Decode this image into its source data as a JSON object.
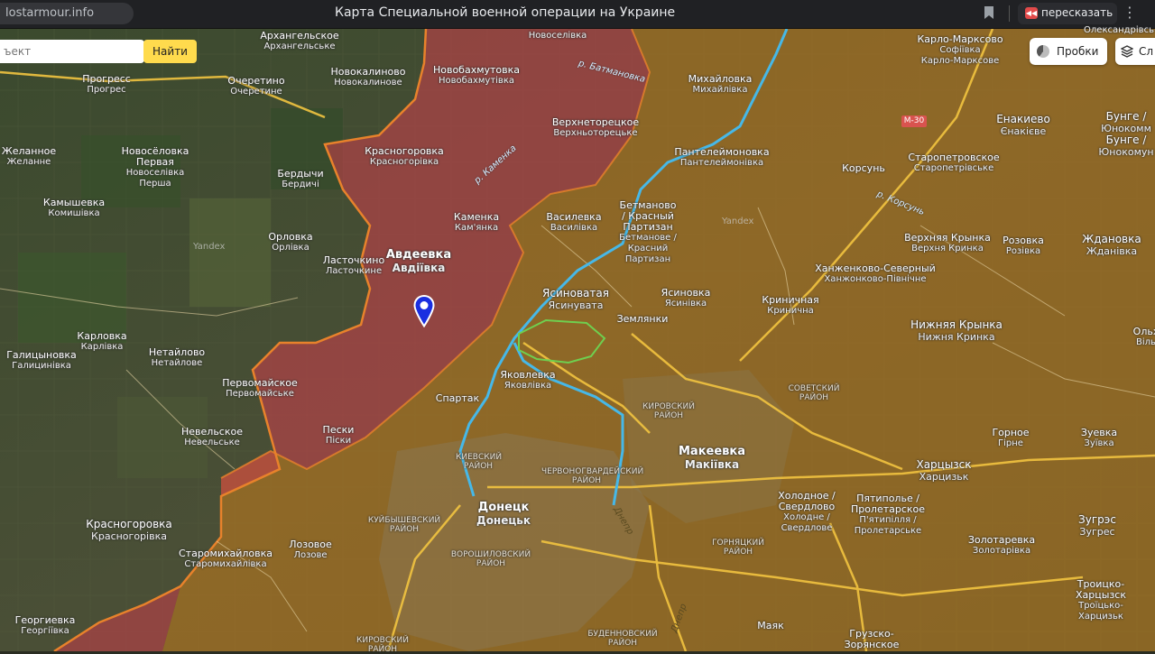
{
  "browser": {
    "url": "lostarmour.info",
    "title": "Карта Специальной военной операции на Украине",
    "retell_label": "пересказать",
    "icons": [
      "bookmark-icon",
      "retell-icon",
      "more-icon"
    ]
  },
  "search": {
    "placeholder": "ъект",
    "button_label": "Найти"
  },
  "controls": {
    "traffic_label": "Пробки",
    "layers_label": "Сл"
  },
  "map": {
    "road_badge": "М-30",
    "watermark": "Yandex",
    "colors": {
      "occupied_zone": "#b8781f",
      "gained_zone": "#c0404a",
      "frontline": "#e8822b",
      "river": "#46b8e8",
      "green_outline": "#6fcf4f",
      "pin": "#1a2fe0"
    },
    "cities": {
      "donetsk": {
        "ru": "Донецк",
        "ua": "Донецьк"
      },
      "makeevka": {
        "ru": "Макеевка",
        "ua": "Макіївка"
      },
      "avdeevka": {
        "ru": "Авдеевка",
        "ua": "Авдіївка"
      },
      "yasinovataya": {
        "ru": "Ясиноватая",
        "ua": "Ясинувата"
      },
      "khartsyzsk": {
        "ru": "Харцызск",
        "ua": "Харцизьк"
      },
      "krasnogorovka_sw": {
        "ru": "Красногоровка",
        "ua": "Красногорівка"
      },
      "enakievo": {
        "ru": "Енакиево",
        "ua": "Єнакієве"
      },
      "nizh_krynka": {
        "ru": "Нижняя Крынка",
        "ua": "Нижня Кринка"
      },
      "zhdanovka": {
        "ru": "Ждановка",
        "ua": "Жданівка"
      },
      "zugres": {
        "ru": "Зугрэс",
        "ua": "Зугрес"
      },
      "bunge": {
        "ru": "Бунге /",
        "ua": "Юнокомм"
      },
      "bunge2": {
        "ru": "Бунге /",
        "ua": "Юнокомун"
      }
    },
    "towns": {
      "arkhangelskoe": {
        "ru": "Архангельское",
        "ua": "Архангельське"
      },
      "novoselovka": {
        "ru": "Новоселівка",
        "ua": ""
      },
      "novokalinovo": {
        "ru": "Новокалиново",
        "ua": "Новокалинове"
      },
      "novobakhmutovka": {
        "ru": "Новобахмутовка",
        "ua": "Новобахмутівка"
      },
      "progress": {
        "ru": "Прогресс",
        "ua": "Прогрес"
      },
      "ocheretino": {
        "ru": "Очеретино",
        "ua": "Очеретине"
      },
      "verkhnetoretskoe": {
        "ru": "Верхнеторецкое",
        "ua": "Верхньоторецьке"
      },
      "zhelannoe": {
        "ru": "Желанное",
        "ua": "Желанне"
      },
      "novoselovka_pervaya": {
        "ru": "Новосёловка",
        "ua": "Первая"
      },
      "novoselivka_persha": {
        "ru": "Новоселівка",
        "ua": "Перша"
      },
      "krasnogorovka_n": {
        "ru": "Красногоровка",
        "ua": "Красногорівка"
      },
      "berdychi": {
        "ru": "Бердычи",
        "ua": "Бердичі"
      },
      "kamyshevka": {
        "ru": "Камышевка",
        "ua": "Комишівка"
      },
      "orlovka": {
        "ru": "Орловка",
        "ua": "Орлівка"
      },
      "kamenka": {
        "ru": "Каменка",
        "ua": "Кам'янка"
      },
      "lastochkino": {
        "ru": "Ласточкино",
        "ua": "Ласточкине"
      },
      "vasilevka": {
        "ru": "Василевка",
        "ua": "Василівка"
      },
      "betmanovo": {
        "ru": "Бетманово / Красный Партизан",
        "ua": "Бетманове / Красний Партизан"
      },
      "mikhaylovka": {
        "ru": "Михайловка",
        "ua": "Михайлівка"
      },
      "panteleymonovka": {
        "ru": "Пантелеймоновка",
        "ua": "Пантелеймонівка"
      },
      "korsun": {
        "ru": "Корсунь",
        "ua": ""
      },
      "staropetrovskoe": {
        "ru": "Старопетровское",
        "ua": "Старопетрівське"
      },
      "karlo_marksovo": {
        "ru": "Карло-Марксово",
        "ua": "Карло-Марксове"
      },
      "sofievka": {
        "ru": "Софіївка",
        "ua": ""
      },
      "aleksandrovka": {
        "ru": "Олександрівсь",
        "ua": ""
      },
      "karlovka": {
        "ru": "Карловка",
        "ua": "Карлівка"
      },
      "netaylovo": {
        "ru": "Нетайлово",
        "ua": "Нетайлове"
      },
      "galitsynovka": {
        "ru": "Галицыновка",
        "ua": "Галицинівка"
      },
      "pervomayskoe": {
        "ru": "Первомайское",
        "ua": "Первомайське"
      },
      "nevelskoe": {
        "ru": "Невельское",
        "ua": "Невельське"
      },
      "peski": {
        "ru": "Пески",
        "ua": "Піски"
      },
      "spartak": {
        "ru": "Спартак",
        "ua": ""
      },
      "yakovlevka": {
        "ru": "Яковлевка",
        "ua": "Яковлівка"
      },
      "yasinovka": {
        "ru": "Ясиновка",
        "ua": "Ясинівка"
      },
      "zemlyanki": {
        "ru": "Землянки",
        "ua": ""
      },
      "krinichnaya": {
        "ru": "Криничная",
        "ua": "Кринична"
      },
      "verkhnyaya_krynka": {
        "ru": "Верхняя Крынка",
        "ua": "Верхня Кринка"
      },
      "rozovka": {
        "ru": "Розовка",
        "ua": "Розівка"
      },
      "khanzhenkovo": {
        "ru": "Ханженково-Северный",
        "ua": "Ханжонково-Північне"
      },
      "gornoe": {
        "ru": "Горное",
        "ua": "Гірне"
      },
      "zuevka": {
        "ru": "Зуевка",
        "ua": "Зуївка"
      },
      "olkhovatka": {
        "ru": "Ольх",
        "ua": "Віль"
      },
      "kholodnoe": {
        "ru": "Холодное / Свердлово",
        "ua": "Холодне / Свердлове"
      },
      "pyatipole": {
        "ru": "Пятиполье / Пролетарское",
        "ua": "П'ятипілля / Пролетарське"
      },
      "zolotarevka": {
        "ru": "Золотаревка",
        "ua": "Золотарівка"
      },
      "troitsko": {
        "ru": "Троицко-",
        "ua": "Харцызск"
      },
      "troitsko2": {
        "ru": "Троїцько-",
        "ua": "Харцизьк"
      },
      "staromikhaylovka": {
        "ru": "Старомихайловка",
        "ua": "Старомихайлівка"
      },
      "lozovoe": {
        "ru": "Лозовое",
        "ua": "Лозове"
      },
      "georgievka": {
        "ru": "Георгиевка",
        "ua": "Георгіївка"
      },
      "mayak": {
        "ru": "Маяк",
        "ua": ""
      },
      "gruzsko": {
        "ru": "Грузско-",
        "ua": "Зорянское"
      }
    },
    "districts": {
      "kievsky": "КИЕВСКИЙ РАЙОН",
      "kuybyshevsky": "КУЙБЫШЕВСКИЙ РАЙОН",
      "chervonogvardeysky": "ЧЕРВОНОГВАРДЕЙСКИЙ РАЙОН",
      "voroshilovsky": "ВОРОШИЛОВСКИЙ РАЙОН",
      "kirovsky_mak": "КИРОВСКИЙ РАЙОН",
      "sovetsky": "СОВЕТСКИЙ РАЙОН",
      "gornyatsky": "ГОРНЯЦКИЙ РАЙОН",
      "kirovsky_don": "КИРОВСКИЙ РАЙОН",
      "budennovsky": "БУДЕННОВСКИЙ РАЙОН"
    },
    "rivers": {
      "batmanovka": "р. Батмановка",
      "kamenka": "р. Каменка",
      "korsun": "р. Корсунь"
    },
    "roads": {
      "dnepr1": "Днепр",
      "dnepr2": "Днепр"
    }
  }
}
